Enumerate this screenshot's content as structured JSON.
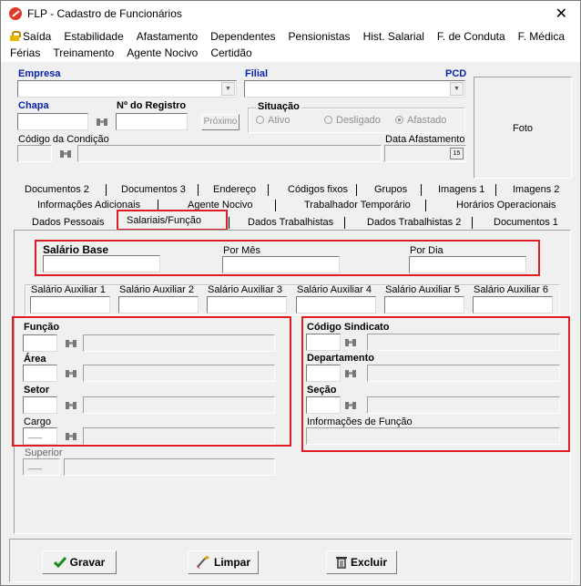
{
  "window": {
    "title": "FLP - Cadastro de Funcionários",
    "close": "✕"
  },
  "menu": {
    "row1": [
      "Saída",
      "Estabilidade",
      "Afastamento",
      "Dependentes",
      "Pensionistas",
      "Hist. Salarial",
      "F. de Conduta",
      "F. Médica"
    ],
    "row2": [
      "Férias",
      "Treinamento",
      "Agente Nocivo",
      "Certidão"
    ]
  },
  "header": {
    "empresa_label": "Empresa",
    "filial_label": "Filial",
    "pcd_label": "PCD",
    "chapa_label": "Chapa",
    "registro_label": "Nº do Registro",
    "proximo_button": "Próximo",
    "situacao_label": "Situação",
    "situacao_options": [
      "Ativo",
      "Desligado",
      "Afastado"
    ],
    "situacao_selected": "Afastado",
    "codigo_condicao_label": "Código da Condição",
    "data_afastamento_label": "Data Afastamento",
    "calendar_label": "15",
    "foto_label": "Foto"
  },
  "tabs": {
    "row1": [
      "Documentos 2",
      "Documentos 3",
      "Endereço",
      "Códigos fixos",
      "Grupos",
      "Imagens 1",
      "Imagens 2"
    ],
    "row2": [
      "Informações Adicionais",
      "Agente Nocivo",
      "Trabalhador Temporário",
      "Horários Operacionais"
    ],
    "row3": [
      "Dados Pessoais",
      "Salariais/Função",
      "Dados Trabalhistas",
      "Dados Trabalhistas 2",
      "Documentos 1"
    ],
    "active": "Salariais/Função"
  },
  "salarios": {
    "base_label": "Salário Base",
    "por_mes_label": "Por Mês",
    "por_dia_label": "Por Dia",
    "auxiliares": [
      "Salário Auxiliar 1",
      "Salário Auxiliar 2",
      "Salário Auxiliar 3",
      "Salário Auxiliar 4",
      "Salário Auxiliar 5",
      "Salário Auxiliar 6"
    ]
  },
  "funcao": {
    "funcao_label": "Função",
    "area_label": "Área",
    "setor_label": "Setor",
    "cargo_label": "Cargo",
    "cargo_value": "___",
    "superior_label": "Superior",
    "superior_value": "___"
  },
  "sindicato": {
    "codigo_label": "Código Sindicato",
    "departamento_label": "Departamento",
    "secao_label": "Seção",
    "info_label": "Informações de Função"
  },
  "buttons": {
    "gravar": "Gravar",
    "limpar": "Limpar",
    "excluir": "Excluir"
  },
  "colors": {
    "highlight": "#e01b24",
    "label_blue": "#0a24a8"
  }
}
